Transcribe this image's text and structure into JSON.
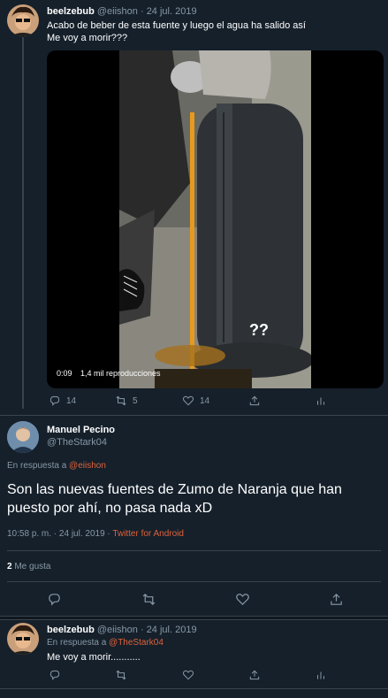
{
  "tweet1": {
    "display_name": "beelzebub",
    "handle": "@eiishon",
    "separator": "·",
    "date": "24 jul. 2019",
    "text_line1": "Acabo de beber de esta fuente y luego el agua ha salido así",
    "text_line2": "Me voy a morir???",
    "video_overlay_text": "??",
    "video_time": "0:09",
    "video_views": "1,4 mil reproducciones",
    "replies": "14",
    "retweets": "5",
    "likes": "14"
  },
  "tweet2": {
    "display_name": "Manuel Pecino",
    "handle": "@TheStark04",
    "reply_prefix": "En respuesta a",
    "reply_to": "@eiishon",
    "text_line1": "Son las nuevas fuentes de Zumo de Naranja que han",
    "text_line2": "puesto por ahí, no pasa nada xD",
    "time": "10:58 p. m. · 24 jul. 2019 ·",
    "client": "Twitter for Android",
    "likes_count": "2",
    "likes_label": "Me gusta"
  },
  "tweet3": {
    "display_name": "beelzebub",
    "handle": "@eiishon",
    "separator": "·",
    "date": "24 jul. 2019",
    "reply_prefix": "En respuesta a",
    "reply_to": "@TheStark04",
    "text": "Me voy a morir..........."
  },
  "colors": {
    "background": "#15202b",
    "accent": "#e0623a",
    "muted": "#8899a6",
    "divider": "#38444d"
  },
  "icons": [
    "reply-icon",
    "retweet-icon",
    "heart-icon",
    "share-icon",
    "analytics-icon"
  ]
}
